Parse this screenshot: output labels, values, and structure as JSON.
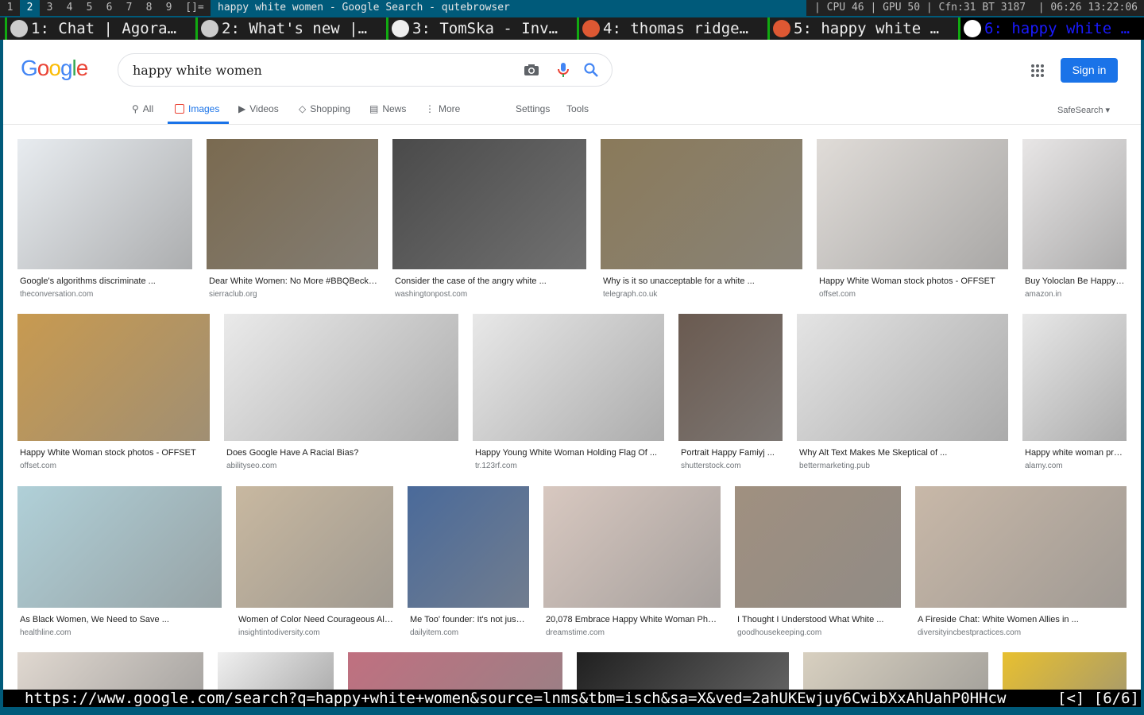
{
  "wm": {
    "workspaces": [
      "1",
      "2",
      "3",
      "4",
      "5",
      "6",
      "7",
      "8",
      "9"
    ],
    "current": "2",
    "layout": "[]=",
    "title": "happy white women - Google Search - qutebrowser",
    "sysinfo": "| CPU 46 | GPU 50 | Cfn:31 BT 3187  | 06:26 13:22:06"
  },
  "tabs": [
    {
      "label": "1: Chat | Agora…",
      "icon": "computer-icon",
      "color": "#ccc"
    },
    {
      "label": "2: What's new |…",
      "icon": "computer-icon",
      "color": "#ccc"
    },
    {
      "label": "3: TomSka - Inv…",
      "icon": "invidious-icon",
      "color": "#eee"
    },
    {
      "label": "4: thomas ridge…",
      "icon": "duckduckgo-icon",
      "color": "#de5833"
    },
    {
      "label": "5: happy white …",
      "icon": "duckduckgo-icon",
      "color": "#de5833"
    },
    {
      "label": "6: happy white …",
      "icon": "google-icon",
      "color": "#fff",
      "active": true
    }
  ],
  "google": {
    "logo": "Google",
    "query": "happy white women",
    "sign_in": "Sign in",
    "nav": [
      "All",
      "Images",
      "Videos",
      "Shopping",
      "News",
      "More"
    ],
    "settings": "Settings",
    "tools": "Tools",
    "safesearch": "SafeSearch ▾",
    "active_tab": "Images"
  },
  "results": [
    [
      {
        "title": "Google's algorithms discriminate ...",
        "source": "theconversation.com"
      },
      {
        "title": "Dear White Women: No More #BBQBeck…",
        "source": "sierraclub.org"
      },
      {
        "title": "Consider the case of the angry white ...",
        "source": "washingtonpost.com"
      },
      {
        "title": "Why is it so unacceptable for a white ...",
        "source": "telegraph.co.uk"
      },
      {
        "title": "Happy White Woman stock photos - OFFSET",
        "source": "offset.com"
      },
      {
        "title": "Buy Yoloclan Be Happy…",
        "source": "amazon.in"
      }
    ],
    [
      {
        "title": "Happy White Woman stock photos - OFFSET",
        "source": "offset.com"
      },
      {
        "title": "Does Google Have A Racial Bias?",
        "source": "abilityseo.com"
      },
      {
        "title": "Happy Young White Woman Holding Flag Of ...",
        "source": "tr.123rf.com"
      },
      {
        "title": "Portrait Happy Famiyj ...",
        "source": "shutterstock.com"
      },
      {
        "title": "Why Alt Text Makes Me Skeptical of ...",
        "source": "bettermarketing.pub"
      },
      {
        "title": "Happy white woman pr…",
        "source": "alamy.com"
      }
    ],
    [
      {
        "title": "As Black Women, We Need to Save ...",
        "source": "healthline.com"
      },
      {
        "title": "Women of Color Need Courageous Al…",
        "source": "insightintodiversity.com"
      },
      {
        "title": "Me Too' founder: It's not jus…",
        "source": "dailyitem.com"
      },
      {
        "title": "20,078 Embrace Happy White Woman Ph…",
        "source": "dreamstime.com"
      },
      {
        "title": "I Thought I Understood What White ...",
        "source": "goodhousekeeping.com"
      },
      {
        "title": "A Fireside Chat: White Women Allies in ...",
        "source": "diversityincbestpractices.com"
      }
    ]
  ],
  "status": {
    "url": "https://www.google.com/search?q=happy+white+women&source=lnms&tbm=isch&sa=X&ved=2ahUKEwjuy6CwibXxAhUahP0HHcw",
    "position": "[<] [6/6]"
  }
}
